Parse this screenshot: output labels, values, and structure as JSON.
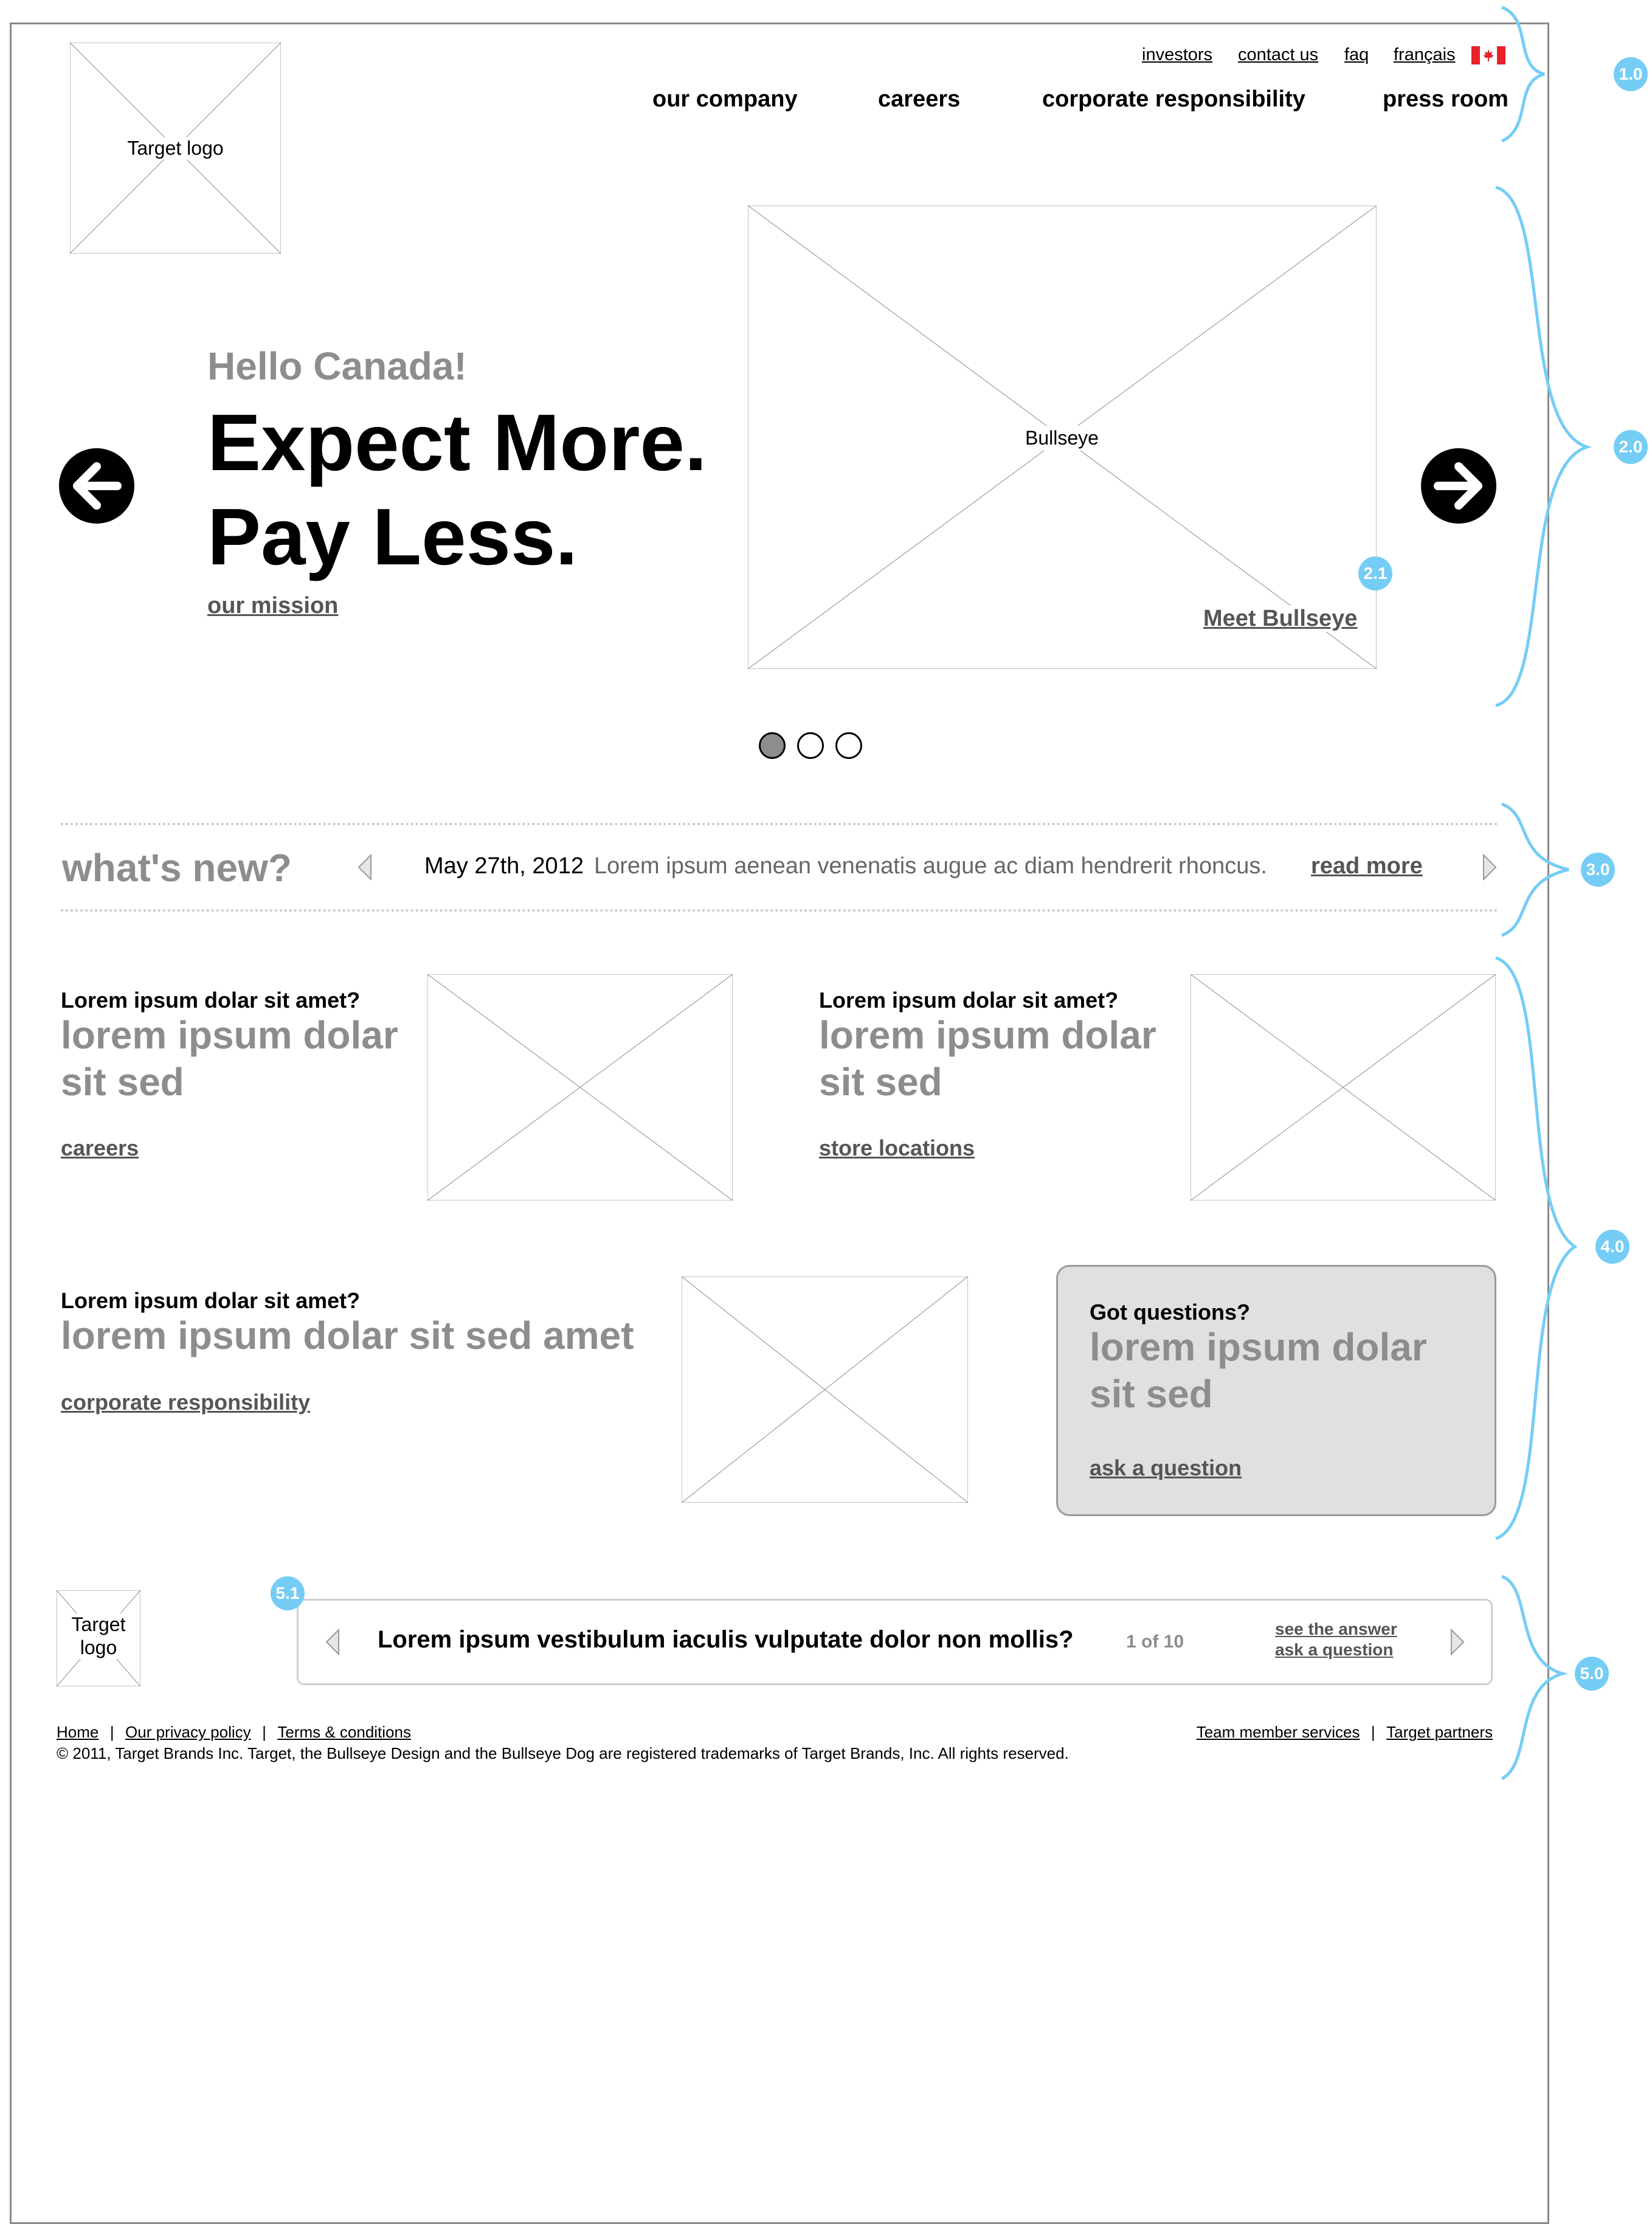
{
  "utility_nav": [
    {
      "label": "investors"
    },
    {
      "label": "contact us"
    },
    {
      "label": "faq"
    },
    {
      "label": "français"
    }
  ],
  "main_nav": [
    {
      "label": "our company"
    },
    {
      "label": "careers"
    },
    {
      "label": "corporate responsibility"
    },
    {
      "label": "press room"
    }
  ],
  "logo": {
    "label": "Target logo"
  },
  "hero": {
    "greeting": "Hello Canada!",
    "headline_1": "Expect More.",
    "headline_2": "Pay Less.",
    "mission_link": "our mission",
    "image_label": "Bullseye",
    "image_link": "Meet Bullseye",
    "slides_total": 3,
    "slide_active": 1
  },
  "whats_new": {
    "heading": "what's new?",
    "date": "May 27th, 2012",
    "text": "Lorem ipsum aenean venenatis augue ac diam hendrerit rhoncus.",
    "read_more": "read more"
  },
  "promos": [
    {
      "question": "Lorem ipsum dolar sit amet?",
      "line1": "lorem ipsum dolar",
      "line2": "sit sed",
      "link": "careers"
    },
    {
      "question": "Lorem ipsum dolar sit amet?",
      "line1": "lorem ipsum dolar",
      "line2": "sit sed",
      "link": "store locations"
    },
    {
      "question": "Lorem ipsum dolar sit amet?",
      "line1": "lorem ipsum dolar sit sed amet",
      "link": "corporate responsibility"
    }
  ],
  "questions_box": {
    "title": "Got questions?",
    "line1": "lorem ipsum dolar",
    "line2": "sit sed",
    "link": "ask a question"
  },
  "faq_ticker": {
    "logo_line1": "Target",
    "logo_line2": "logo",
    "question": "Lorem ipsum vestibulum iaculis vulputate dolor non mollis?",
    "counter": "1 of 10",
    "see_answer": "see the answer",
    "ask_question": "ask a question"
  },
  "footer": {
    "links_left": [
      "Home",
      "Our privacy policy",
      "Terms & conditions"
    ],
    "links_right": [
      "Team member services",
      "Target partners"
    ],
    "separator": "|",
    "copyright": "© 2011, Target Brands Inc. Target, the Bullseye Design and the Bullseye Dog are registered trademarks of Target Brands, Inc. All rights reserved."
  },
  "annotations": [
    "1.0",
    "2.0",
    "2.1",
    "3.0",
    "4.0",
    "5.0",
    "5.1"
  ],
  "colors": {
    "annotation_blue": "#75cdf5",
    "muted_text": "#8d8d8d",
    "link_text": "#555555",
    "box_fill": "#e0e0e0",
    "flag_red": "#e8212b"
  }
}
